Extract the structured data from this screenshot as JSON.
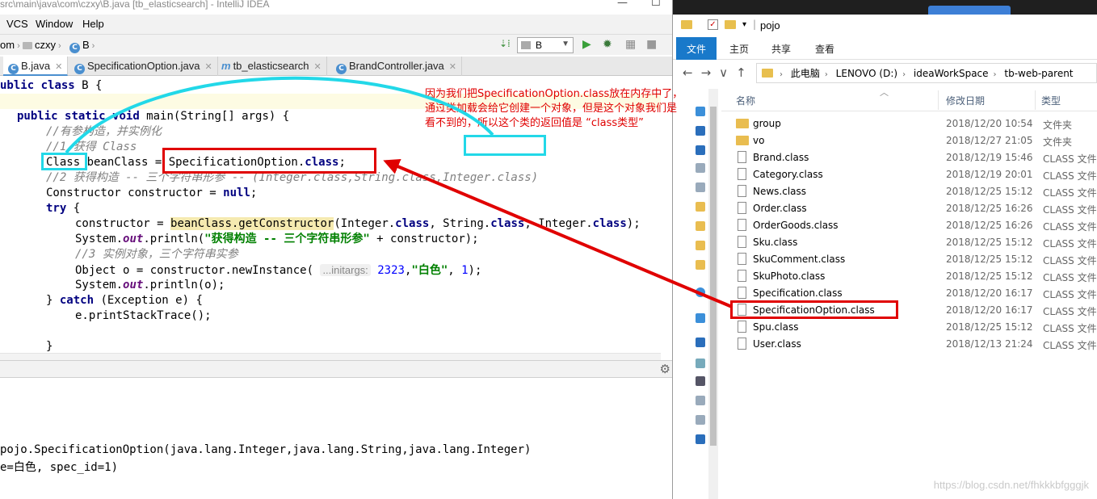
{
  "ide": {
    "title": "src\\main\\java\\com\\czxy\\B.java [tb_elasticsearch] - IntelliJ IDEA",
    "menu": [
      "VCS",
      "Window",
      "Help"
    ],
    "breadcrumb": [
      "om",
      "czxy",
      "B"
    ],
    "run_config": "B",
    "tabs": [
      {
        "label": "B.java",
        "active": true
      },
      {
        "label": "SpecificationOption.java",
        "active": false
      },
      {
        "label": "tb_elasticsearch",
        "active": false
      },
      {
        "label": "BrandController.java",
        "active": false
      }
    ],
    "code": {
      "l1_kw1": "ublic",
      "l1_kw2": "class",
      "l1_rest": " B {",
      "l3_kw1": "public",
      "l3_kw2": "static",
      "l3_kw3": "void",
      "l3_rest": " main(String[] args) {",
      "c1": "//有参构造，并实例化",
      "c2": "//1 获得 Class",
      "l6_a": "Class beanClass = SpecificationOption.",
      "l6_kw": "class",
      "l6_b": ";",
      "c3": "//2 获得构造 -- 三个字符串形参 -- (Integer.class,String.class,Integer.class)",
      "l8_a": "Constructor constructor = ",
      "l8_kw": "null",
      "l8_b": ";",
      "l9_kw": "try",
      "l9_b": " {",
      "l10_a": "constructor = ",
      "l10_usage": "beanClass.getConstructor",
      "l10_b": "(Integer.",
      "l10_kw1": "class",
      "l10_c": ", String.",
      "l10_kw2": "class",
      "l10_d": ", Integer.",
      "l10_kw3": "class",
      "l10_e": ");",
      "l11_a": "System.",
      "l11_out": "out",
      "l11_b": ".println(",
      "l11_str": "\"获得构造 -- 三个字符串形参\"",
      "l11_c": " + constructor);",
      "c4": "//3 实例对象，三个字符串实参",
      "l13_a": "Object o = constructor.newInstance( ",
      "l13_hint": "...initargs:",
      "l13_num1": "2323",
      "l13_b": ",",
      "l13_str": "\"白色\"",
      "l13_c": ", ",
      "l13_num2": "1",
      "l13_d": ");",
      "l14_a": "System.",
      "l14_out": "out",
      "l14_b": ".println(o);",
      "l15_a": "} ",
      "l15_kw": "catch",
      "l15_b": " (Exception e) {",
      "l16": "e.printStackTrace();",
      "l18": "}"
    },
    "console": [
      "pojo.SpecificationOption(java.lang.Integer,java.lang.String,java.lang.Integer)",
      "e=白色, spec_id=1)"
    ]
  },
  "explorer": {
    "title": "pojo",
    "ribbon": [
      "文件",
      "主页",
      "共享",
      "查看"
    ],
    "path": [
      "此电脑",
      "LENOVO (D:)",
      "ideaWorkSpace",
      "tb-web-parent"
    ],
    "columns": {
      "name": "名称",
      "date": "修改日期",
      "type": "类型"
    },
    "files": [
      {
        "name": "group",
        "date": "2018/12/20 10:54",
        "type": "文件夹",
        "folder": true
      },
      {
        "name": "vo",
        "date": "2018/12/27 21:05",
        "type": "文件夹",
        "folder": true
      },
      {
        "name": "Brand.class",
        "date": "2018/12/19 15:46",
        "type": "CLASS 文件",
        "folder": false
      },
      {
        "name": "Category.class",
        "date": "2018/12/19 20:01",
        "type": "CLASS 文件",
        "folder": false
      },
      {
        "name": "News.class",
        "date": "2018/12/25 15:12",
        "type": "CLASS 文件",
        "folder": false
      },
      {
        "name": "Order.class",
        "date": "2018/12/25 16:26",
        "type": "CLASS 文件",
        "folder": false
      },
      {
        "name": "OrderGoods.class",
        "date": "2018/12/25 16:26",
        "type": "CLASS 文件",
        "folder": false
      },
      {
        "name": "Sku.class",
        "date": "2018/12/25 15:12",
        "type": "CLASS 文件",
        "folder": false
      },
      {
        "name": "SkuComment.class",
        "date": "2018/12/25 15:12",
        "type": "CLASS 文件",
        "folder": false
      },
      {
        "name": "SkuPhoto.class",
        "date": "2018/12/25 15:12",
        "type": "CLASS 文件",
        "folder": false
      },
      {
        "name": "Specification.class",
        "date": "2018/12/20 16:17",
        "type": "CLASS 文件",
        "folder": false
      },
      {
        "name": "SpecificationOption.class",
        "date": "2018/12/20 16:17",
        "type": "CLASS 文件",
        "folder": false
      },
      {
        "name": "Spu.class",
        "date": "2018/12/25 15:12",
        "type": "CLASS 文件",
        "folder": false
      },
      {
        "name": "User.class",
        "date": "2018/12/13 21:24",
        "type": "CLASS 文件",
        "folder": false
      }
    ]
  },
  "annotation": {
    "note_main": "因为我们把SpecificationOption.class放在内存中了，通过类加载会给它创建一个对象，但是这个对象我们是看不到的，所以这个类的返回值是",
    "note_highlight": "“class类型”",
    "color_red": "#e00000",
    "color_cyan": "#22d8e8"
  },
  "watermark": "https://blog.csdn.net/fhkkkbfgggjk"
}
